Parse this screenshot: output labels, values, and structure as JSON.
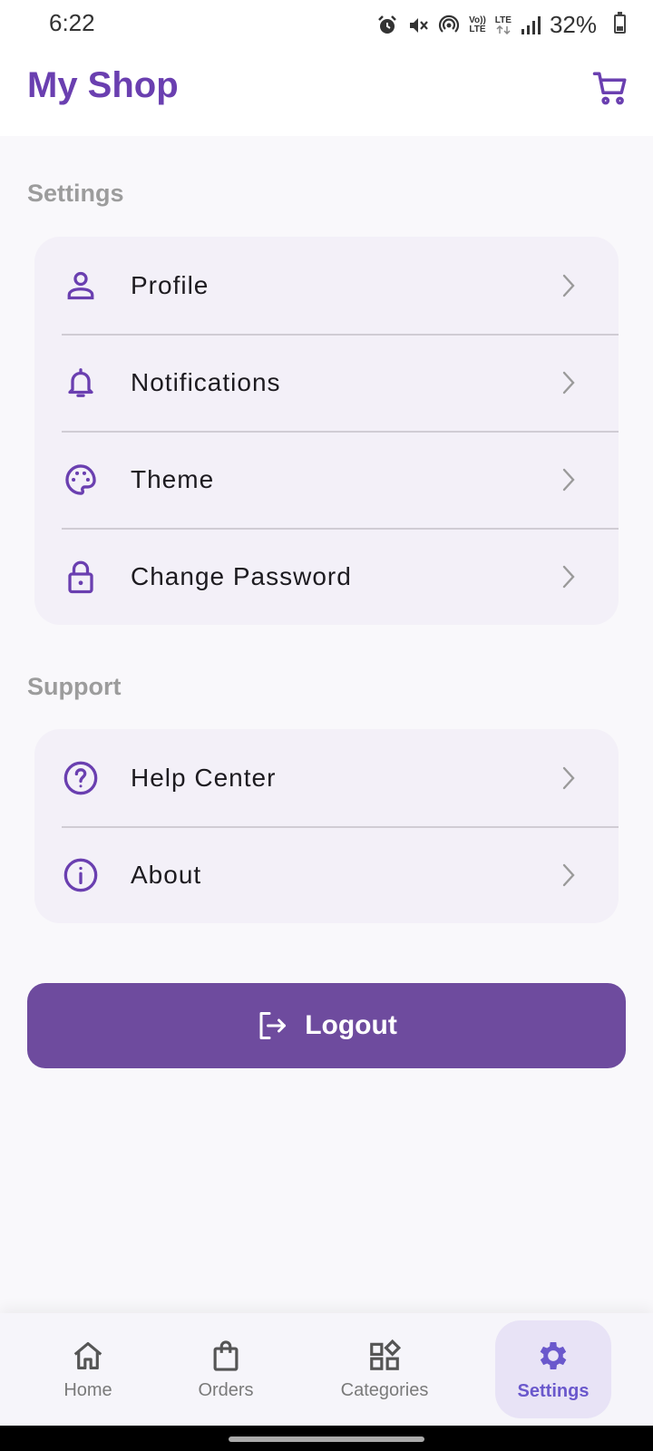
{
  "status_bar": {
    "time": "6:22",
    "lte_top": "Vo))",
    "lte_bottom": "LTE",
    "lte2": "LTE",
    "battery": "32%",
    "battery_level": 0.32
  },
  "app_bar": {
    "title": "My Shop",
    "cart_icon": "shopping-cart-icon"
  },
  "colors": {
    "primary": "#6a3fb0",
    "button": "#6e4b9e",
    "card": "#f3f0f8",
    "active_nav": "#6a58cc"
  },
  "settings_section": {
    "title": "Settings",
    "items": [
      {
        "label": "Profile",
        "icon": "person-icon"
      },
      {
        "label": "Notifications",
        "icon": "bell-icon"
      },
      {
        "label": "Theme",
        "icon": "palette-icon"
      },
      {
        "label": "Change Password",
        "icon": "lock-icon"
      }
    ]
  },
  "support_section": {
    "title": "Support",
    "items": [
      {
        "label": "Help Center",
        "icon": "help-circle-icon"
      },
      {
        "label": "About",
        "icon": "info-icon"
      }
    ]
  },
  "logout": {
    "label": "Logout",
    "icon": "logout-icon"
  },
  "bottom_nav": {
    "items": [
      {
        "label": "Home",
        "icon": "home-icon"
      },
      {
        "label": "Orders",
        "icon": "shopping-bag-icon"
      },
      {
        "label": "Categories",
        "icon": "categories-icon"
      },
      {
        "label": "Settings",
        "icon": "gear-icon",
        "active": true
      }
    ]
  }
}
